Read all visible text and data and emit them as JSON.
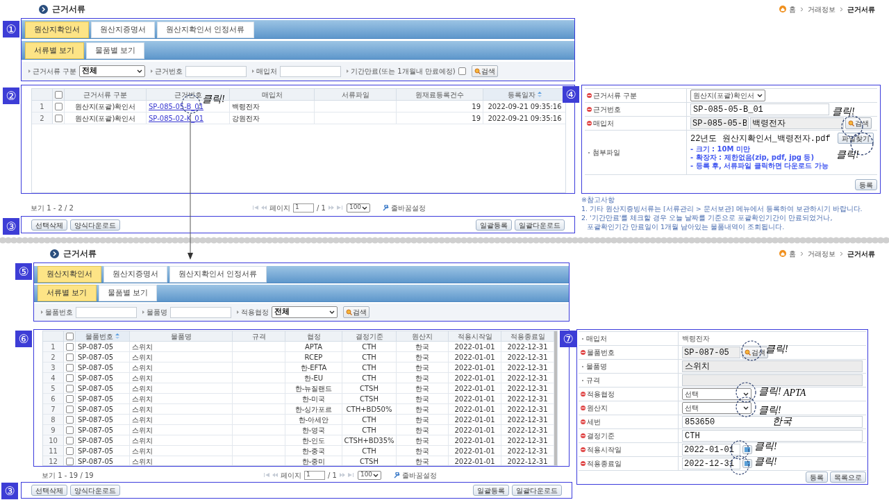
{
  "top": {
    "header": {
      "title": "근거서류",
      "breadcrumb": [
        "홈",
        "거래정보",
        "근거서류"
      ]
    },
    "badges": [
      "①",
      "②",
      "③",
      "④"
    ],
    "tabs": [
      {
        "label": "원산지확인서",
        "selected": true
      },
      {
        "label": "원산지증명서",
        "selected": false
      },
      {
        "label": "원산지확인서 인정서류",
        "selected": false
      }
    ],
    "subtabs": [
      {
        "label": "서류별 보기",
        "selected": true
      },
      {
        "label": "물품별 보기",
        "selected": false
      }
    ],
    "filters": [
      {
        "kind": "select",
        "label": "근거서류 구분",
        "value": "전체"
      },
      {
        "kind": "input",
        "label": "근거번호"
      },
      {
        "kind": "input",
        "label": "매입처"
      },
      {
        "kind": "checkbox",
        "label": "기간만료(또는 1개월내 만료예정)",
        "checked": false
      },
      {
        "kind": "button",
        "label": "검색"
      }
    ],
    "grid": {
      "header_checked": false,
      "columns": [
        {
          "label": "근거서류 구분",
          "sorted": false,
          "kind": "text"
        },
        {
          "label": "근거번호",
          "sorted": false,
          "kind": "link"
        },
        {
          "label": "매입처",
          "sorted": false,
          "kind": "text"
        },
        {
          "label": "서류파일",
          "sorted": false,
          "kind": "text"
        },
        {
          "label": "원재료등록건수",
          "sorted": false,
          "kind": "text"
        },
        {
          "label": "등록일자",
          "sorted": true,
          "kind": "text"
        }
      ],
      "rows": [
        {
          "num": "1",
          "checked": false,
          "doc_type": "원산지(포괄)확인서",
          "doc_no": "SP-085-05-B_01",
          "purchaser": "백령전자",
          "count": "19",
          "date": "2022-09-21 09:35:16"
        },
        {
          "num": "2",
          "checked": false,
          "doc_type": "원산지(포괄)확인서",
          "doc_no": "SP-085-02-K_01",
          "purchaser": "강원전자",
          "count": "19",
          "date": "2022-09-21 09:35:16"
        }
      ]
    },
    "pager": {
      "summary": "보기 1 - 2 / 2",
      "page_label": "페이지",
      "page": "1",
      "total": "/ 1",
      "page_size": "100",
      "wrap_setting": "줄바꿈설정"
    },
    "actions_left": [
      "선택삭제",
      "양식다운로드"
    ],
    "actions_right": [
      "일괄등록",
      "일괄다운로드"
    ],
    "form": {
      "rows": [
        {
          "kind": "select",
          "label": "근거서류 구분",
          "required": true,
          "value": "원산지(포괄)확인서"
        },
        {
          "kind": "input",
          "label": "근거번호",
          "required": true,
          "value": "SP-085-05-B_01"
        },
        {
          "kind": "search",
          "label": "매입처",
          "required": true,
          "values": [
            "SP-085-05-B",
            "백령전자"
          ],
          "button": "검색"
        },
        {
          "kind": "file",
          "label": "첨부파일",
          "required": false,
          "value": "22년도 원산지확인서_백령전자.pdf",
          "hints": [
            "- 크기 : 10M 미만",
            "- 확장자 : 제한없음(zip, pdf, jpg 등)",
            "- 등록 후, 서류파일 클릭하면 다운로드 가능"
          ],
          "button": "파일찾기"
        }
      ],
      "buttons": [
        "등록"
      ]
    },
    "notes": [
      "※참고사항",
      "1. 기타 원산지증빙서류는 [서류관리 > 문서보관] 메뉴에서 등록하여 보관하시기 바랍니다.",
      "2. '기간만료'를 체크할 경우 오늘 날짜를 기준으로 포괄확인기간이 만료되었거나,",
      "포괄확인기간 만료일이 1개월 남아있는 물품내역이 조회됩니다."
    ]
  },
  "bottom": {
    "header": {
      "title": "근거서류",
      "breadcrumb": [
        "홈",
        "거래정보",
        "근거서류"
      ]
    },
    "badges": [
      "⑤",
      "⑥",
      "③",
      "⑦"
    ],
    "tabs": [
      {
        "label": "원산지확인서",
        "selected": true
      },
      {
        "label": "원산지증명서",
        "selected": false
      },
      {
        "label": "원산지확인서 인정서류",
        "selected": false
      }
    ],
    "subtabs": [
      {
        "label": "서류별 보기",
        "selected": true
      },
      {
        "label": "물품별 보기",
        "selected": false
      }
    ],
    "filters": [
      {
        "kind": "input",
        "label": "물품번호"
      },
      {
        "kind": "input",
        "label": "물품명"
      },
      {
        "kind": "select",
        "label": "적용협정",
        "value": "전체"
      },
      {
        "kind": "button",
        "label": "검색"
      }
    ],
    "grid": {
      "header_checked": false,
      "columns": [
        {
          "label": "물품번호",
          "sorted": true
        },
        {
          "label": "물품명",
          "sorted": false
        },
        {
          "label": "규격",
          "sorted": false
        },
        {
          "label": "협정",
          "sorted": false
        },
        {
          "label": "결정기준",
          "sorted": false
        },
        {
          "label": "원산지",
          "sorted": false
        },
        {
          "label": "적용시작일",
          "sorted": false
        },
        {
          "label": "적용종료일",
          "sorted": false
        }
      ],
      "rows": [
        {
          "num": "1",
          "checked": false,
          "item_no": "SP-087-05",
          "name": "스위치",
          "fta": "APTA",
          "criterion": "CTH",
          "origin": "한국",
          "start": "2022-01-01",
          "end": "2022-12-31"
        },
        {
          "num": "2",
          "checked": false,
          "item_no": "SP-087-05",
          "name": "스위치",
          "fta": "RCEP",
          "criterion": "CTH",
          "origin": "한국",
          "start": "2022-01-01",
          "end": "2022-12-31"
        },
        {
          "num": "3",
          "checked": false,
          "item_no": "SP-087-05",
          "name": "스위치",
          "fta": "한-EFTA",
          "criterion": "CTH",
          "origin": "한국",
          "start": "2022-01-01",
          "end": "2022-12-31"
        },
        {
          "num": "4",
          "checked": false,
          "item_no": "SP-087-05",
          "name": "스위치",
          "fta": "한-EU",
          "criterion": "CTH",
          "origin": "한국",
          "start": "2022-01-01",
          "end": "2022-12-31"
        },
        {
          "num": "5",
          "checked": false,
          "item_no": "SP-087-05",
          "name": "스위치",
          "fta": "한-뉴질랜드",
          "criterion": "CTSH",
          "origin": "한국",
          "start": "2022-01-01",
          "end": "2022-12-31"
        },
        {
          "num": "6",
          "checked": false,
          "item_no": "SP-087-05",
          "name": "스위치",
          "fta": "한-미국",
          "criterion": "CTSH",
          "origin": "한국",
          "start": "2022-01-01",
          "end": "2022-12-31"
        },
        {
          "num": "7",
          "checked": false,
          "item_no": "SP-087-05",
          "name": "스위치",
          "fta": "한-싱가포르",
          "criterion": "CTH+BD50%",
          "origin": "한국",
          "start": "2022-01-01",
          "end": "2022-12-31"
        },
        {
          "num": "8",
          "checked": false,
          "item_no": "SP-087-05",
          "name": "스위치",
          "fta": "한-아세안",
          "criterion": "CTH",
          "origin": "한국",
          "start": "2022-01-01",
          "end": "2022-12-31"
        },
        {
          "num": "9",
          "checked": false,
          "item_no": "SP-087-05",
          "name": "스위치",
          "fta": "한-영국",
          "criterion": "CTH",
          "origin": "한국",
          "start": "2022-01-01",
          "end": "2022-12-31"
        },
        {
          "num": "10",
          "checked": false,
          "item_no": "SP-087-05",
          "name": "스위치",
          "fta": "한-인도",
          "criterion": "CTSH+BD35%",
          "origin": "한국",
          "start": "2022-01-01",
          "end": "2022-12-31"
        },
        {
          "num": "11",
          "checked": false,
          "item_no": "SP-087-05",
          "name": "스위치",
          "fta": "한-중국",
          "criterion": "CTH",
          "origin": "한국",
          "start": "2022-01-01",
          "end": "2022-12-31"
        },
        {
          "num": "12",
          "checked": false,
          "item_no": "SP-087-05",
          "name": "스위치",
          "fta": "한-중미",
          "criterion": "CTSH",
          "origin": "한국",
          "start": "2022-01-01",
          "end": "2022-12-31"
        }
      ]
    },
    "pager": {
      "summary": "보기 1 - 19 / 19",
      "page_label": "페이지",
      "page": "1",
      "total": "/ 1",
      "page_size": "100",
      "wrap_setting": "줄바꿈설정"
    },
    "actions_left": [
      "선택삭제",
      "양식다운로드"
    ],
    "actions_right": [
      "일괄등록",
      "일괄다운로드"
    ],
    "form": {
      "rows": [
        {
          "kind": "text",
          "label": "매입처",
          "required": false,
          "value": "백령전자"
        },
        {
          "kind": "search",
          "label": "물품번호",
          "required": true,
          "values": [
            "SP-087-05"
          ],
          "button": "검색"
        },
        {
          "kind": "disabled",
          "label": "물품명",
          "required": false,
          "value": "스위치"
        },
        {
          "kind": "disabled",
          "label": "규격",
          "required": false
        },
        {
          "kind": "select",
          "label": "적용협정",
          "required": true,
          "value": "선택"
        },
        {
          "kind": "select",
          "label": "원산지",
          "required": true,
          "value": "선택"
        },
        {
          "kind": "input",
          "label": "세번",
          "required": true,
          "value": "853650"
        },
        {
          "kind": "input",
          "label": "결정기준",
          "required": true,
          "value": "CTH"
        },
        {
          "kind": "date",
          "label": "적용시작일",
          "required": true,
          "value": "2022-01-01"
        },
        {
          "kind": "date",
          "label": "적용종료일",
          "required": true,
          "value": "2022-12-31"
        }
      ],
      "buttons": [
        "등록",
        "목록으로"
      ]
    }
  },
  "annotations": [
    {
      "text": "클릭!"
    },
    {
      "text": "클릭!"
    },
    {
      "text": "클릭!"
    },
    {
      "text": "클릭!"
    },
    {
      "text": "클릭!"
    },
    {
      "text": "APTA"
    },
    {
      "text": "클릭!"
    },
    {
      "text": "한국"
    },
    {
      "text": "클릭!"
    },
    {
      "text": "클릭!"
    }
  ]
}
